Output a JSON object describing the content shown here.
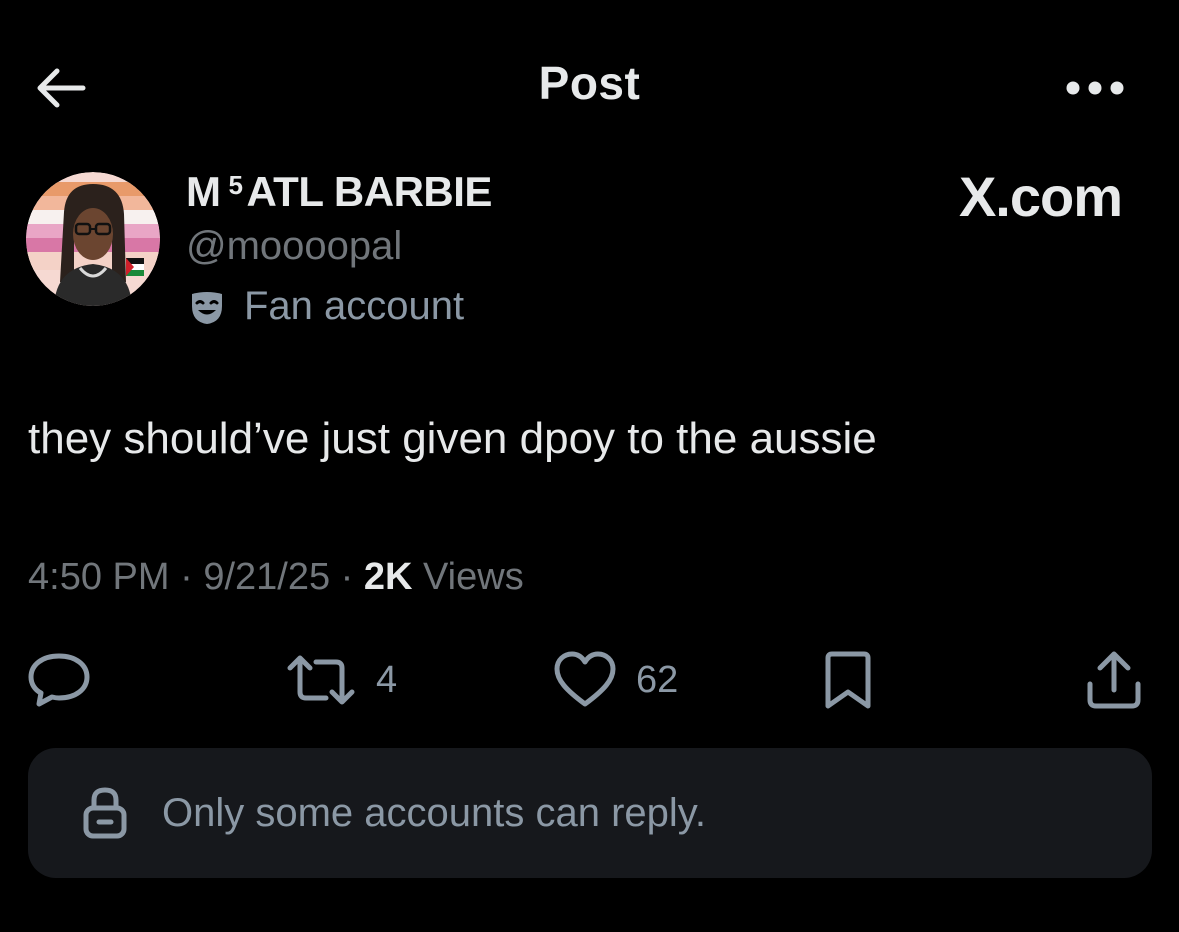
{
  "header": {
    "title": "Post"
  },
  "author": {
    "display_name_prefix": "M",
    "display_name_sup": "5",
    "display_name_suffix": "ATL BARBIE",
    "handle": "@moooopal",
    "label": "Fan account"
  },
  "watermark": "X.com",
  "post": {
    "text": "they should’ve just given dpoy to the aussie"
  },
  "meta": {
    "time": "4:50 PM",
    "sep1": " · ",
    "date": "9/21/25",
    "sep2": " · ",
    "views_count": "2K",
    "views_label": " Views"
  },
  "actions": {
    "reposts": "4",
    "likes": "62"
  },
  "reply_restriction": "Only some accounts can reply.",
  "colors": {
    "background": "#000000",
    "primary_text": "#e7e9ea",
    "secondary_text": "#71767b",
    "icon": "#8b98a5",
    "reply_box": "#16181c"
  },
  "icons": {
    "back": "arrow-left-icon",
    "more": "more-horizontal-icon",
    "label": "theater-mask-icon",
    "reply": "reply-bubble-icon",
    "repost": "repost-icon",
    "like": "heart-icon",
    "bookmark": "bookmark-icon",
    "share": "share-icon",
    "lock": "lock-icon"
  }
}
